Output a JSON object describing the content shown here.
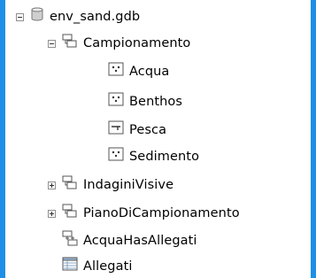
{
  "tree": {
    "root": {
      "label": "env_sand.gdb",
      "icon": "database-icon",
      "expanded": true
    },
    "campionamento": {
      "label": "Campionamento",
      "icon": "feature-dataset-icon",
      "expanded": true
    },
    "acqua": {
      "label": "Acqua",
      "icon": "point-feature-class-icon"
    },
    "benthos": {
      "label": "Benthos",
      "icon": "point-feature-class-icon"
    },
    "pesca": {
      "label": "Pesca",
      "icon": "line-feature-class-icon"
    },
    "sedimento": {
      "label": "Sedimento",
      "icon": "point-feature-class-icon"
    },
    "indagini": {
      "label": "IndaginiVisive",
      "icon": "feature-dataset-icon",
      "expanded": false
    },
    "piano": {
      "label": "PianoDiCampionamento",
      "icon": "feature-dataset-icon",
      "expanded": false
    },
    "hasallegati": {
      "label": "AcquaHasAllegati",
      "icon": "relationship-class-icon"
    },
    "allegati": {
      "label": "Allegati",
      "icon": "table-icon"
    }
  },
  "colors": {
    "background": "#1e8fe6",
    "panel": "#ffffff"
  }
}
